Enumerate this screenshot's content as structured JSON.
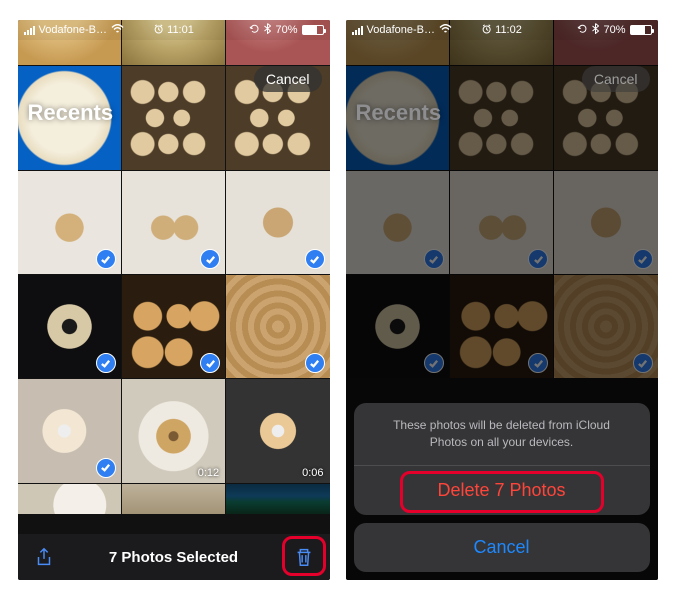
{
  "status": {
    "carrier": "Vodafone-B…",
    "time_left": "11:01",
    "time_right": "11:02",
    "battery_pct": "70%",
    "alarm_icon": "alarm-icon",
    "bluetooth_icon": "bluetooth-icon",
    "sync_icon": "sync-icon"
  },
  "header": {
    "recents_label": "Recents",
    "cancel_label": "Cancel"
  },
  "left": {
    "selection_title": "7 Photos Selected",
    "thumbs": [
      {
        "art": "th-bread1",
        "checked": false,
        "duration": null
      },
      {
        "art": "th-poppy",
        "checked": false,
        "duration": null
      },
      {
        "art": "th-pills",
        "checked": false,
        "duration": null
      },
      {
        "art": "th-dough",
        "checked": false,
        "duration": null
      },
      {
        "art": "th-balls",
        "checked": false,
        "duration": null
      },
      {
        "art": "th-balls",
        "checked": false,
        "duration": null
      },
      {
        "art": "th-cookie",
        "checked": true,
        "duration": null
      },
      {
        "art": "th-cookie-split",
        "checked": true,
        "duration": null
      },
      {
        "art": "th-cookie2",
        "checked": true,
        "duration": null
      },
      {
        "art": "th-donut-dark",
        "checked": true,
        "duration": null
      },
      {
        "art": "th-donuts-pan",
        "checked": true,
        "duration": null
      },
      {
        "art": "th-closeup",
        "checked": true,
        "duration": null
      },
      {
        "art": "th-sugar",
        "checked": true,
        "duration": null
      },
      {
        "art": "th-donut-plate",
        "checked": false,
        "duration": "0:12"
      },
      {
        "art": "th-video",
        "checked": false,
        "duration": "0:06"
      }
    ],
    "partial_row": [
      "th-plate",
      "th-tray",
      "th-trees"
    ]
  },
  "right": {
    "thumbs": [
      {
        "art": "th-bread1",
        "checked": false
      },
      {
        "art": "th-poppy",
        "checked": false
      },
      {
        "art": "th-pills",
        "checked": false
      },
      {
        "art": "th-dough",
        "checked": false
      },
      {
        "art": "th-balls",
        "checked": false
      },
      {
        "art": "th-balls",
        "checked": false
      },
      {
        "art": "th-cookie",
        "checked": true
      },
      {
        "art": "th-cookie-split",
        "checked": true
      },
      {
        "art": "th-cookie2",
        "checked": true
      },
      {
        "art": "th-donut-dark",
        "checked": true
      },
      {
        "art": "th-donuts-pan",
        "checked": true
      },
      {
        "art": "th-closeup",
        "checked": true
      }
    ],
    "sheet": {
      "message": "These photos will be deleted from iCloud Photos on all your devices.",
      "delete_label": "Delete 7 Photos",
      "cancel_label": "Cancel"
    }
  },
  "colors": {
    "accent_blue": "#1e88ff",
    "destructive_red": "#ff453a",
    "highlight_box": "#e4002b",
    "selection_check": "#2f7ff2"
  }
}
